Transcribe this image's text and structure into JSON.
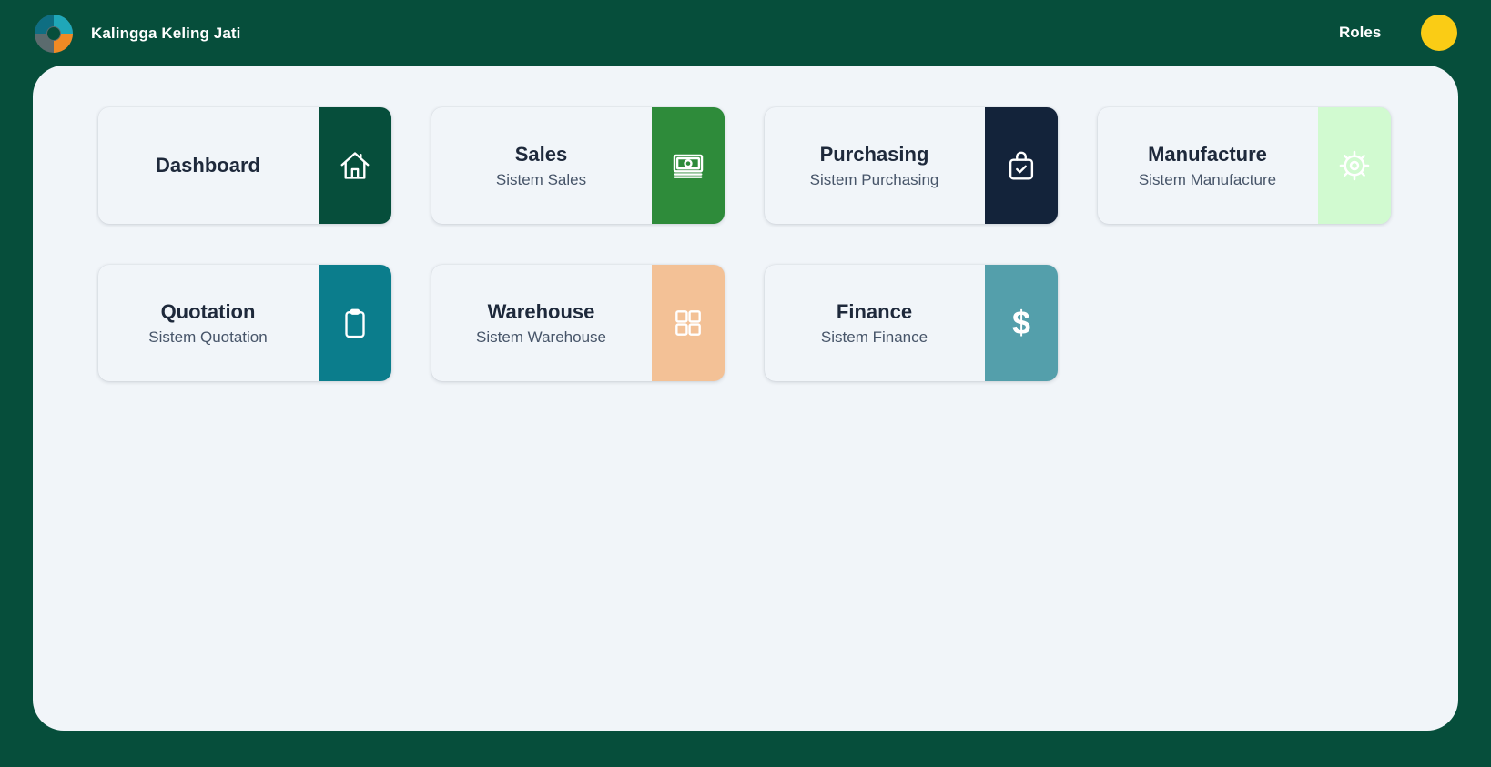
{
  "header": {
    "brand_name": "Kalingga Keling Jati",
    "roles_label": "Roles",
    "avatar_color": "#FACC15",
    "background_color": "#064E3B"
  },
  "cards": [
    {
      "title": "Dashboard",
      "subtitle": "",
      "icon": "home-icon",
      "color": "#064E3B"
    },
    {
      "title": "Sales",
      "subtitle": "Sistem Sales",
      "icon": "cash-icon",
      "color": "#2E8B3A"
    },
    {
      "title": "Purchasing",
      "subtitle": "Sistem Purchasing",
      "icon": "shopping-bag-icon",
      "color": "#13233A"
    },
    {
      "title": "Manufacture",
      "subtitle": "Sistem Manufacture",
      "icon": "gear-icon",
      "color": "#D1FAD0"
    },
    {
      "title": "Quotation",
      "subtitle": "Sistem Quotation",
      "icon": "clipboard-icon",
      "color": "#0B7D8C"
    },
    {
      "title": "Warehouse",
      "subtitle": "Sistem Warehouse",
      "icon": "grid-icon",
      "color": "#F3C196"
    },
    {
      "title": "Finance",
      "subtitle": "Sistem Finance",
      "icon": "dollar-icon",
      "dollar_symbol": "$",
      "color": "#549FAB"
    }
  ]
}
